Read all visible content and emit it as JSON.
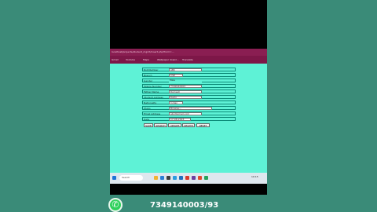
{
  "browser": {
    "url": "localhost/projects/student_mgmt/insert.php?form=...",
    "bookmarks": [
      "Gmail",
      "Youtube",
      "Maps",
      "Wallpaper downl...",
      "Translate"
    ]
  },
  "form": {
    "rows": [
      {
        "label": "Roll Number",
        "value": "ABC"
      },
      {
        "label": "Branch",
        "value": "CSE"
      },
      {
        "label": "Gender",
        "value": "Male"
      },
      {
        "label": "Mobile Number",
        "value": "7349140003"
      },
      {
        "label": "Father Name",
        "value": "Ramesh"
      },
      {
        "label": "Student Address",
        "value": "Delhi"
      },
      {
        "label": "Nationality",
        "value": "Indian"
      },
      {
        "label": "Photo",
        "value": "Browse..."
      },
      {
        "label": "Email Address",
        "value": "abc@gmail.com"
      },
      {
        "label": "Date",
        "value": "17-06-2023"
      }
    ],
    "buttons": [
      "SAVE",
      "SEARCH",
      "UPDATE",
      "DELETE",
      "RESET"
    ]
  },
  "taskbar": {
    "search_placeholder": "Search",
    "time": "10:15"
  },
  "overlay": {
    "phone": "7349140003/93"
  }
}
